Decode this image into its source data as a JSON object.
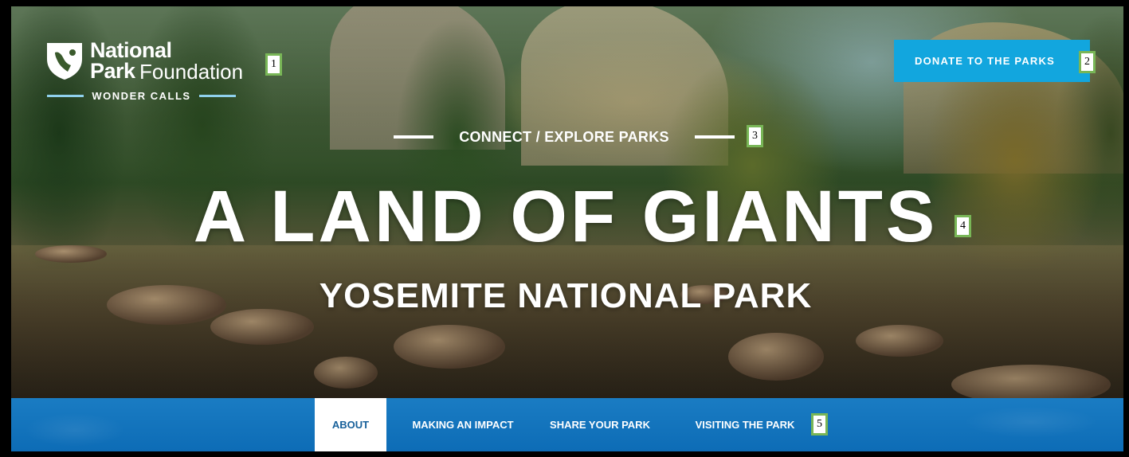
{
  "logo": {
    "line1": "National",
    "line2_bold": "Park",
    "line2_light": "Foundation",
    "tagline": "WONDER CALLS",
    "icon": "arrowhead-icon"
  },
  "header": {
    "donate_label": "DONATE TO THE PARKS"
  },
  "hero": {
    "eyebrow": "CONNECT / EXPLORE PARKS",
    "headline": "A LAND OF GIANTS",
    "subhead": "YOSEMITE NATIONAL PARK"
  },
  "nav": {
    "tabs": [
      {
        "label": "ABOUT",
        "active": true
      },
      {
        "label": "MAKING AN IMPACT",
        "active": false
      },
      {
        "label": "SHARE YOUR PARK",
        "active": false
      },
      {
        "label": "VISITING THE PARK",
        "active": false
      }
    ]
  },
  "annotations": [
    "1",
    "2",
    "3",
    "4",
    "5"
  ],
  "colors": {
    "donate": "#12a6de",
    "nav": "#1a7cc3",
    "active_tab_text": "#17609a",
    "badge_border": "#79b657"
  }
}
